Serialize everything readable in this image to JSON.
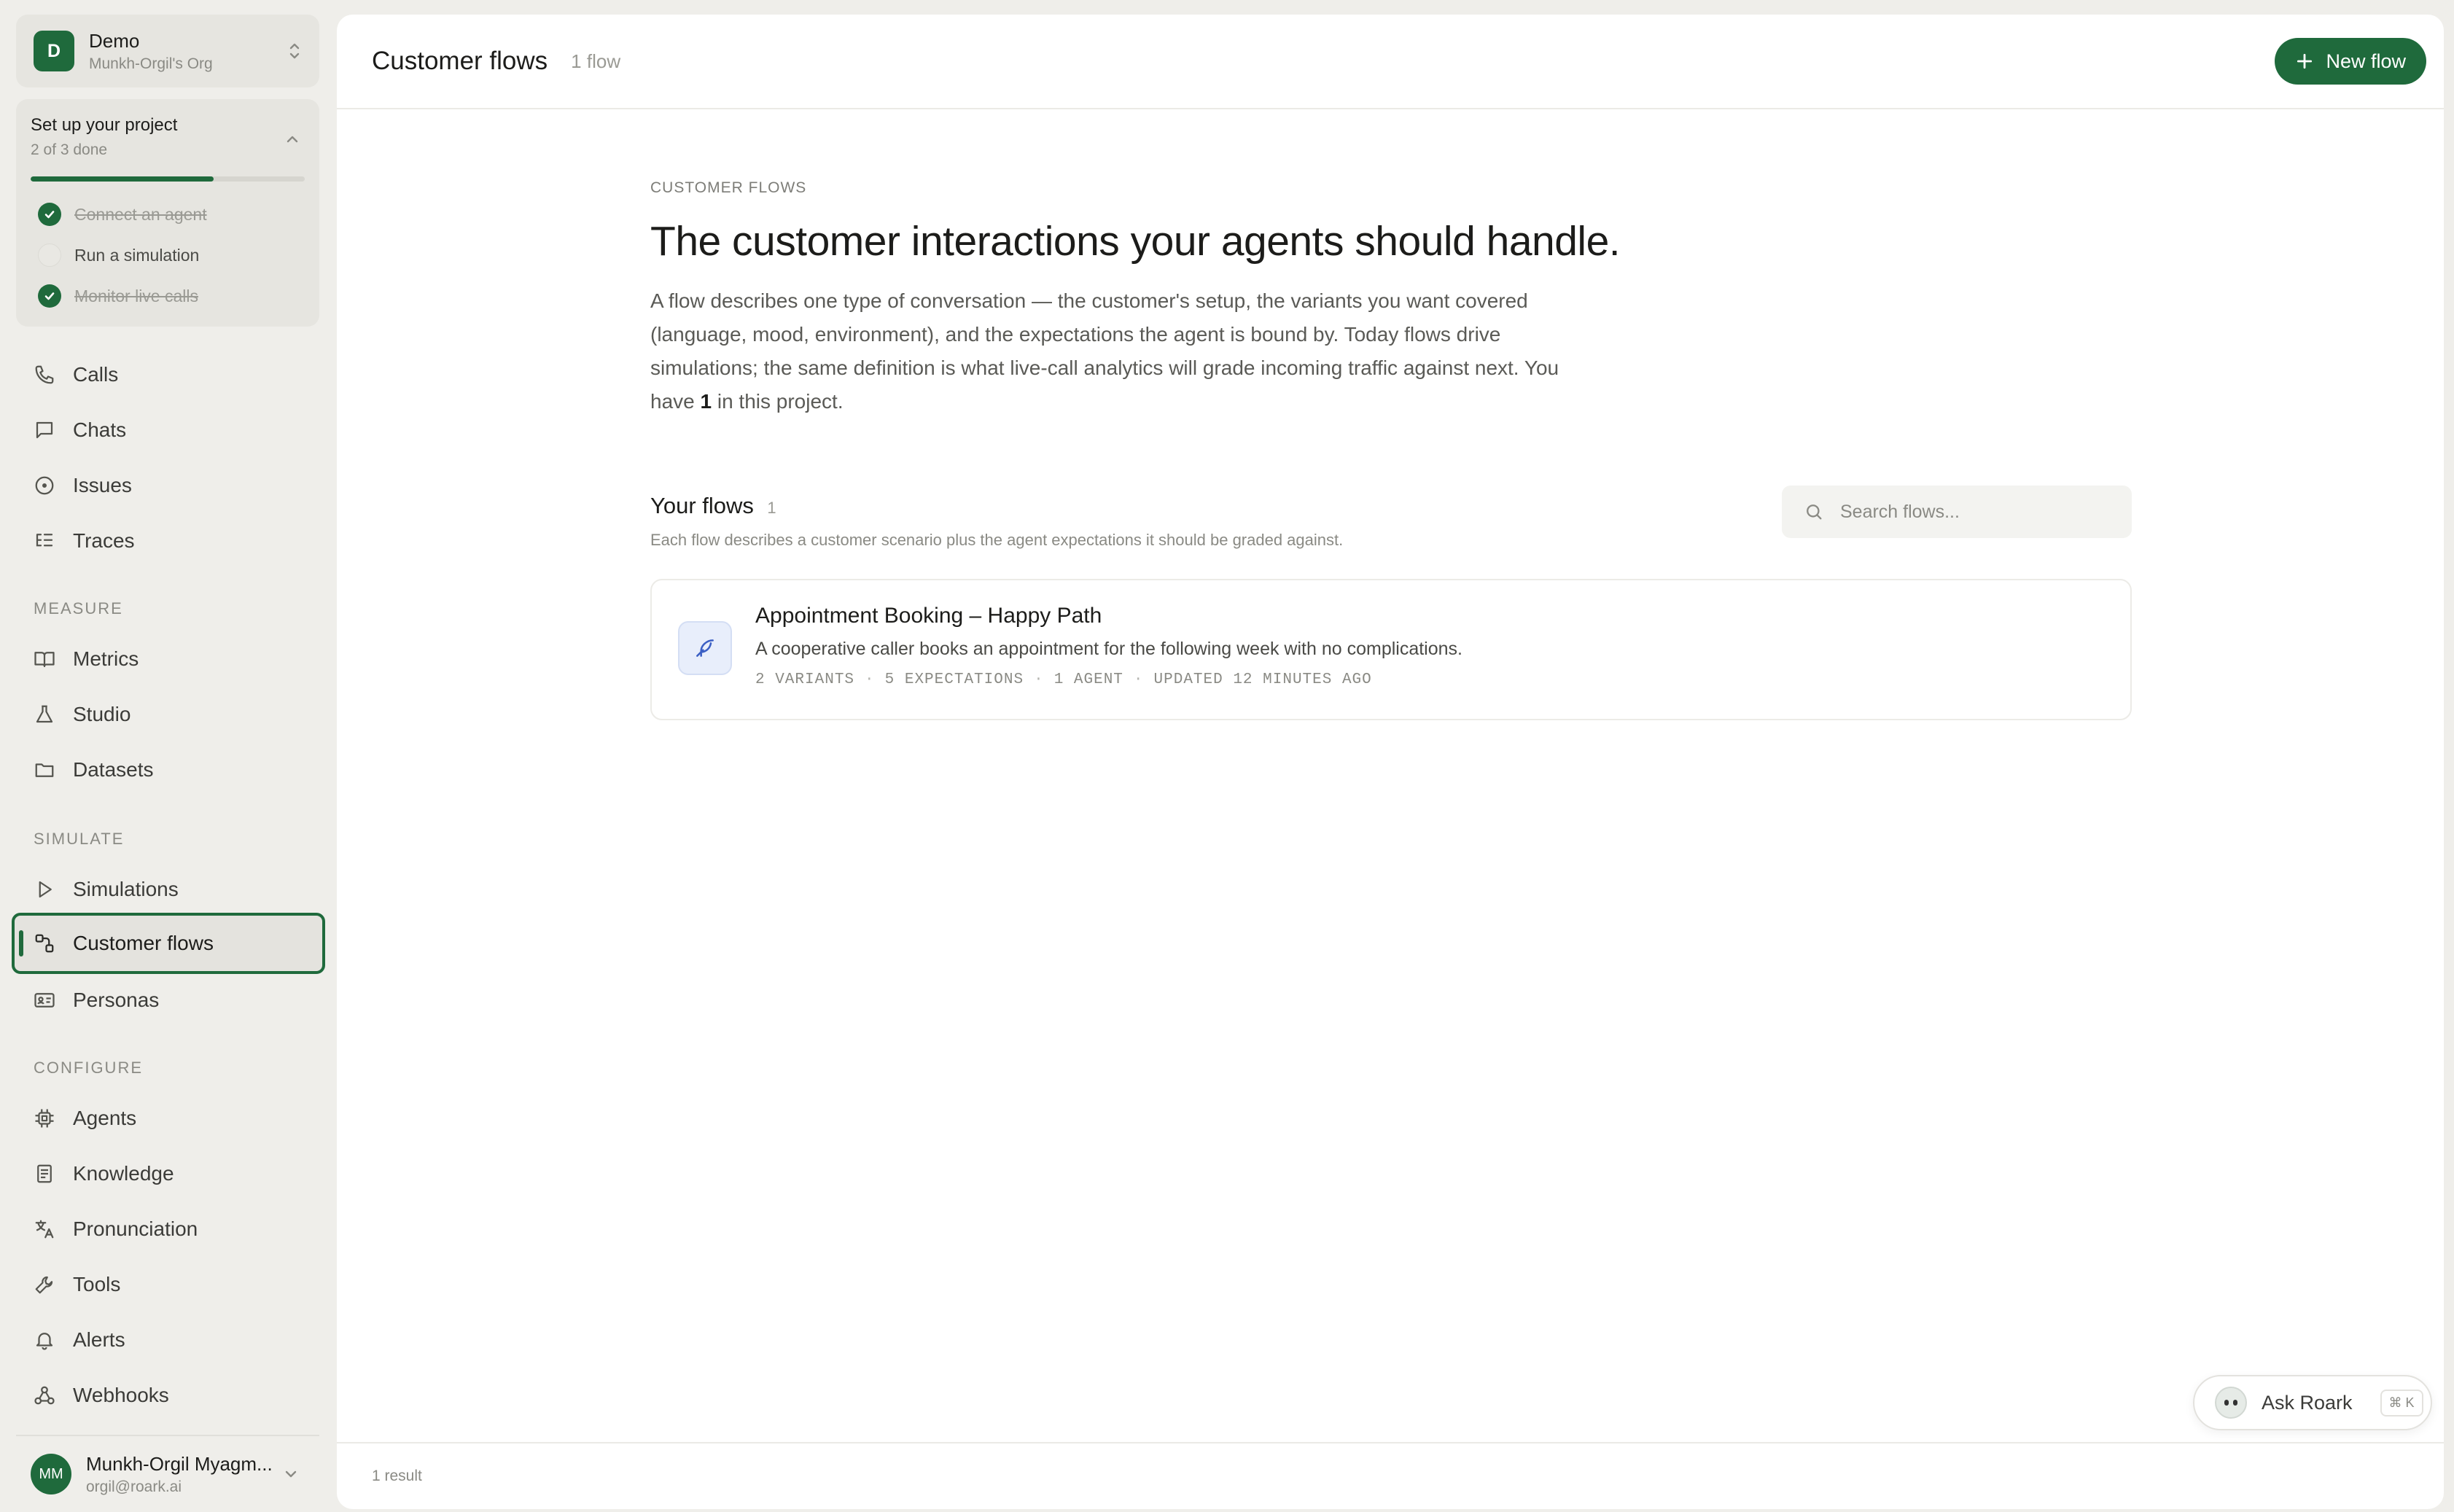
{
  "org": {
    "initial": "D",
    "name": "Demo",
    "subtitle": "Munkh-Orgil's Org"
  },
  "setup": {
    "title": "Set up your project",
    "progress_text": "2 of 3 done",
    "progress_fraction": 0.667,
    "steps": [
      {
        "label": "Connect an agent",
        "done": true
      },
      {
        "label": "Run a simulation",
        "done": false
      },
      {
        "label": "Monitor live calls",
        "done": true
      }
    ]
  },
  "nav": {
    "calls": "Calls",
    "chats": "Chats",
    "issues": "Issues",
    "traces": "Traces",
    "measure_label": "MEASURE",
    "metrics": "Metrics",
    "studio": "Studio",
    "datasets": "Datasets",
    "simulate_label": "SIMULATE",
    "simulations": "Simulations",
    "customer_flows": "Customer flows",
    "personas": "Personas",
    "configure_label": "CONFIGURE",
    "agents": "Agents",
    "knowledge": "Knowledge",
    "pronunciation": "Pronunciation",
    "tools": "Tools",
    "alerts": "Alerts",
    "webhooks": "Webhooks"
  },
  "user": {
    "initials": "MM",
    "name": "Munkh-Orgil Myagm...",
    "email": "orgil@roark.ai"
  },
  "header": {
    "title": "Customer flows",
    "count": "1 flow",
    "new_button": "New flow"
  },
  "intro": {
    "eyebrow": "CUSTOMER FLOWS",
    "headline": "The customer interactions your agents should handle.",
    "description": "A flow describes one type of conversation — the customer's setup, the variants you want covered (language, mood, environment), and the expectations the agent is bound by. Today flows drive simulations; the same definition is what live-call analytics will grade incoming traffic against next.",
    "count_prefix": "You have ",
    "count_value": "1",
    "count_suffix": " in this project."
  },
  "flows": {
    "title": "Your flows",
    "count": "1",
    "subtitle": "Each flow describes a customer scenario plus the agent expectations it should be graded against.",
    "search_placeholder": "Search flows...",
    "items": [
      {
        "name": "Appointment Booking – Happy Path",
        "description": "A cooperative caller books an appointment for the following week with no complications.",
        "variants": "2 VARIANTS",
        "expectations": "5 EXPECTATIONS",
        "agents": "1 AGENT",
        "updated": "UPDATED 12 MINUTES AGO"
      }
    ]
  },
  "footer": {
    "result_count": "1 result"
  },
  "assistant": {
    "label": "Ask Roark",
    "shortcut": "⌘ K"
  },
  "colors": {
    "accent": "#1f6a3c",
    "background": "#efeeea",
    "panel": "#ffffff"
  }
}
